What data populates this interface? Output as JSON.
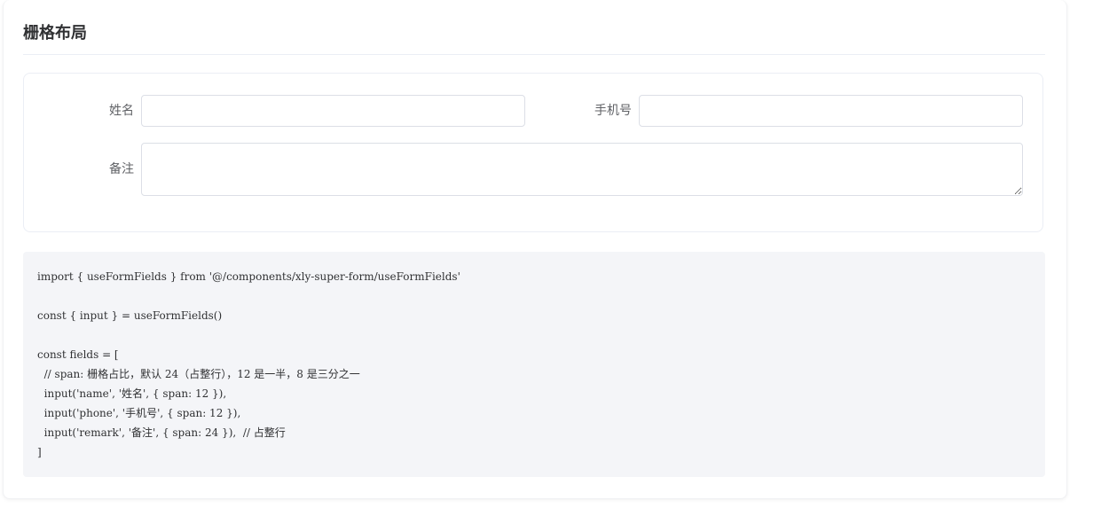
{
  "section": {
    "title": "栅格布局"
  },
  "form": {
    "name_label": "姓名",
    "name_value": "",
    "phone_label": "手机号",
    "phone_value": "",
    "remark_label": "备注",
    "remark_value": ""
  },
  "code": {
    "lines": [
      "import { useFormFields } from '@/components/xly-super-form/useFormFields'",
      "",
      "const { input } = useFormFields()",
      "",
      "const fields = [",
      "  // span: 栅格占比，默认 24（占整行），12 是一半，8 是三分之一",
      "  input('name', '姓名', { span: 12 }),",
      "  input('phone', '手机号', { span: 12 }),",
      "  input('remark', '备注', { span: 24 }),  // 占整行",
      "]"
    ]
  }
}
